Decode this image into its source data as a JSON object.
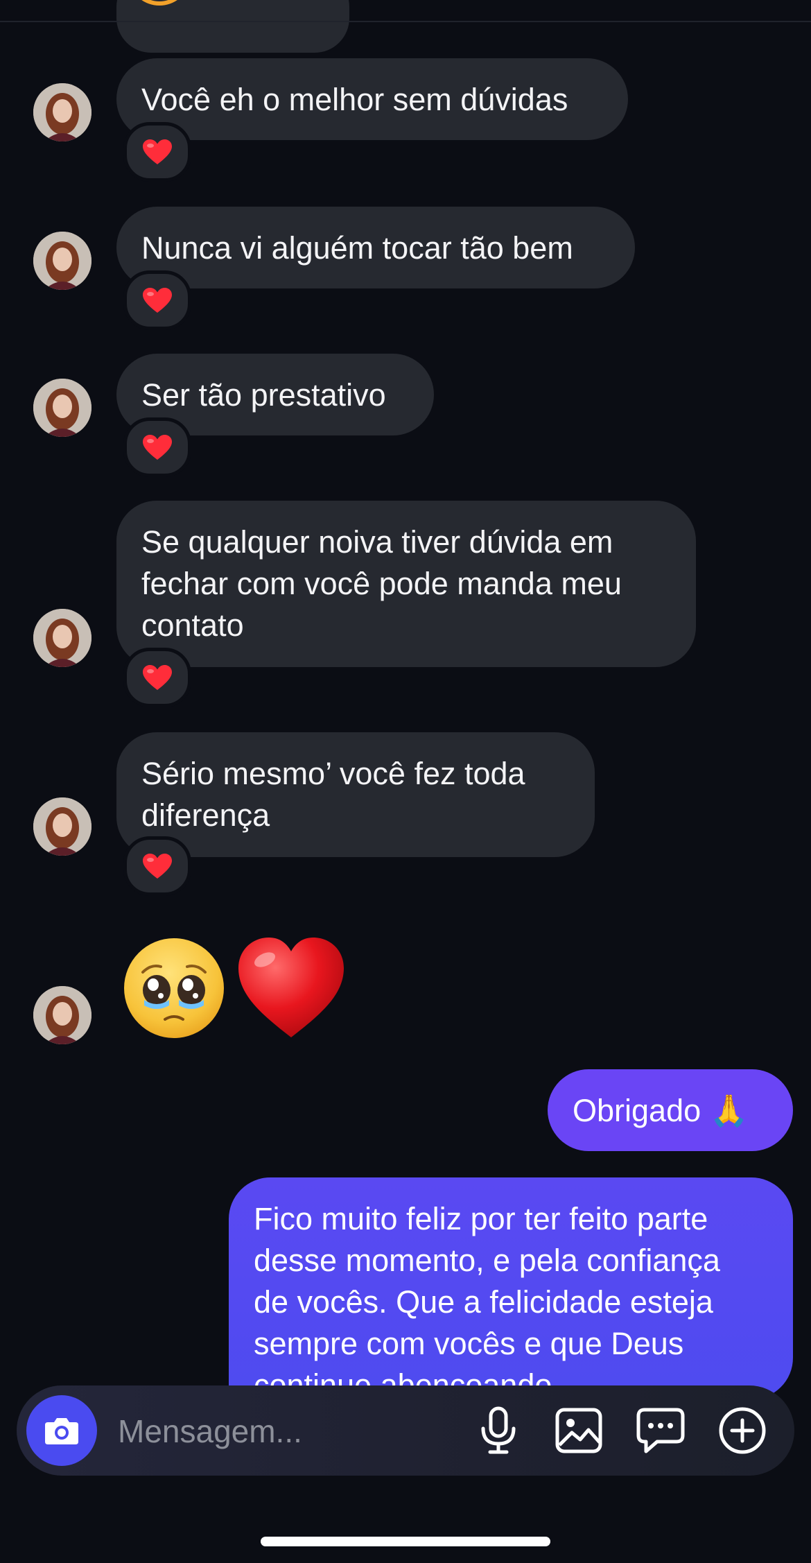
{
  "thread": {
    "received": [
      {
        "text": "Você eh o melhor sem dúvidas",
        "reaction": "heart"
      },
      {
        "text": "Nunca vi alguém tocar tão bem",
        "reaction": "heart"
      },
      {
        "text": "Ser tão prestativo",
        "reaction": "heart"
      },
      {
        "text": "Se qualquer noiva tiver dúvida em fechar com você pode manda meu contato",
        "lines": [
          "Se qualquer noiva tiver dúvida em",
          "fechar com você pode manda meu",
          "contato"
        ],
        "reaction": "heart"
      },
      {
        "text": "Sério mesmo’ você fez toda diferença",
        "lines": [
          "Sério mesmo’ você fez toda",
          "diferença"
        ],
        "reaction": "heart"
      }
    ],
    "emoji_message": [
      "pleading-face",
      "red-heart"
    ],
    "sent": [
      {
        "text": "Obrigado 🙏"
      },
      {
        "lines": [
          "Fico muito feliz por ter feito parte",
          "desse momento, e pela confiança",
          "de vocês. Que a felicidade esteja",
          "sempre com vocês e que Deus",
          "continue abençoando"
        ]
      }
    ]
  },
  "composer": {
    "placeholder": "Mensagem...",
    "icons": [
      "camera-icon",
      "microphone-icon",
      "image-icon",
      "sticker-icon",
      "plus-icon"
    ]
  },
  "colors": {
    "background": "#0b0d14",
    "received_bubble": "#262930",
    "sent_bubble": "#6a45f5",
    "camera_button": "#4a4bf0",
    "reaction_heart": "#ff2d3a"
  }
}
